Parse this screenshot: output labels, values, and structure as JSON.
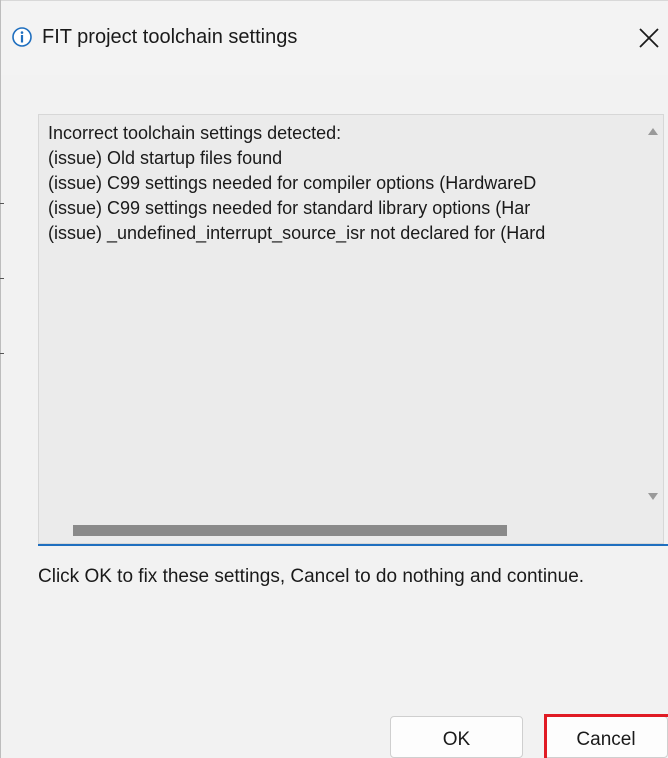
{
  "dialog": {
    "title": "FIT project toolchain settings",
    "title_icon": "info-icon",
    "close_icon": "close-icon"
  },
  "log": {
    "lines": [
      "Incorrect toolchain settings detected:",
      "(issue) Old startup files found",
      "(issue) C99 settings needed for compiler options (HardwareD",
      "(issue) C99 settings needed for standard library options (Har",
      "(issue) _undefined_interrupt_source_isr not declared for (Hard"
    ],
    "scroll_up_icon": "scroll-up-arrow-icon",
    "scroll_down_icon": "scroll-down-arrow-icon"
  },
  "message": "Click OK to fix these settings, Cancel to do nothing and continue.",
  "buttons": {
    "ok": "OK",
    "cancel": "Cancel"
  },
  "colors": {
    "highlight": "#e01b24",
    "focus_line": "#1f6fbf",
    "info_icon": "#1f6fbf"
  }
}
